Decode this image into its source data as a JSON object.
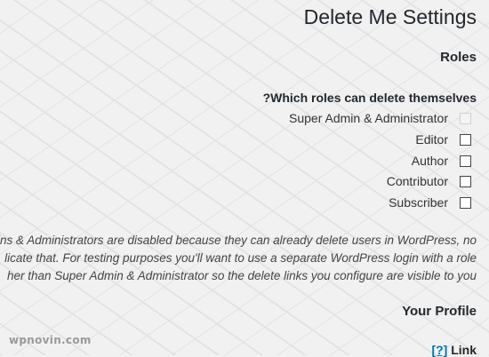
{
  "page": {
    "title": "Delete Me Settings"
  },
  "roles": {
    "heading": "Roles",
    "question": "?Which roles can delete themselves",
    "items": [
      {
        "label": "Super Admin & Administrator",
        "checked": false,
        "disabled": true
      },
      {
        "label": "Editor",
        "checked": false,
        "disabled": false
      },
      {
        "label": "Author",
        "checked": false,
        "disabled": false
      },
      {
        "label": "Contributor",
        "checked": false,
        "disabled": false
      },
      {
        "label": "Subscriber",
        "checked": false,
        "disabled": false
      }
    ],
    "description_lines": [
      "ins & Administrators are disabled because they can already delete users in WordPress, no",
      "licate that. For testing purposes you'll want to use a separate WordPress login with a role",
      "her than Super Admin & Administrator so the delete links you configure are visible to you"
    ]
  },
  "profile": {
    "heading": "Your Profile",
    "help_text": "[?]",
    "link_label": "Link"
  },
  "watermark": {
    "text": "wpnovin.com"
  },
  "colors": {
    "background": "#f1f1f1",
    "heading": "#23282d",
    "link": "#0073aa"
  }
}
